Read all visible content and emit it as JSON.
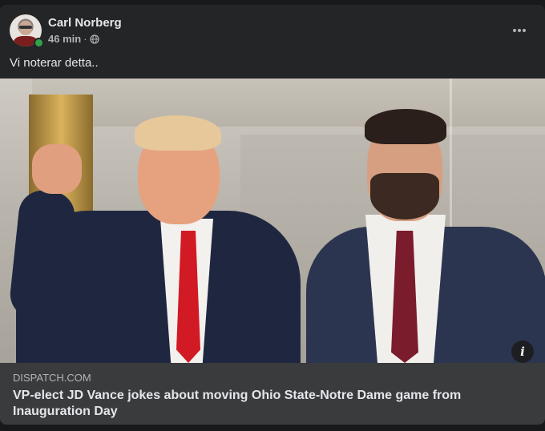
{
  "post": {
    "author": "Carl Norberg",
    "time": "46 min",
    "separator": "·",
    "text": "Vi noterar detta..",
    "more_icon": "more-horizontal-icon",
    "privacy_icon": "globe-icon"
  },
  "link_preview": {
    "domain": "DISPATCH.COM",
    "headline": "VP-elect JD Vance jokes about moving Ohio State-Notre Dame game from Inauguration Day",
    "info_icon": "info-icon",
    "info_glyph": "i"
  },
  "colors": {
    "background": "#18191a",
    "card": "#242526",
    "preview": "#3a3b3c",
    "online": "#31a24c"
  }
}
